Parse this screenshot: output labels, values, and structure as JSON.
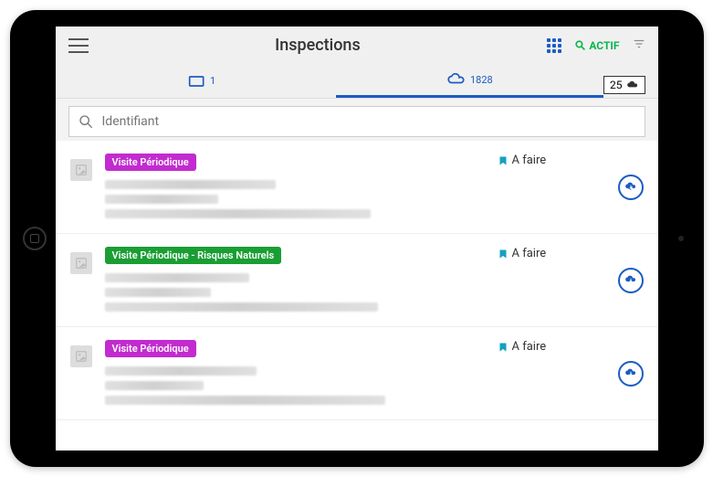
{
  "header": {
    "title": "Inspections",
    "actif_label": "ACTIF"
  },
  "tabs": {
    "local_count": "1",
    "cloud_count": "1828",
    "page_size": "25"
  },
  "search": {
    "placeholder": "Identifiant"
  },
  "status_label": "A faire",
  "items": [
    {
      "badge_text": "Visite Périodique",
      "badge_color": "#c22bcf",
      "status": "A faire"
    },
    {
      "badge_text": "Visite Périodique - Risques Naturels",
      "badge_color": "#1a9e34",
      "status": "A faire"
    },
    {
      "badge_text": "Visite Périodique",
      "badge_color": "#c22bcf",
      "status": "A faire"
    }
  ]
}
